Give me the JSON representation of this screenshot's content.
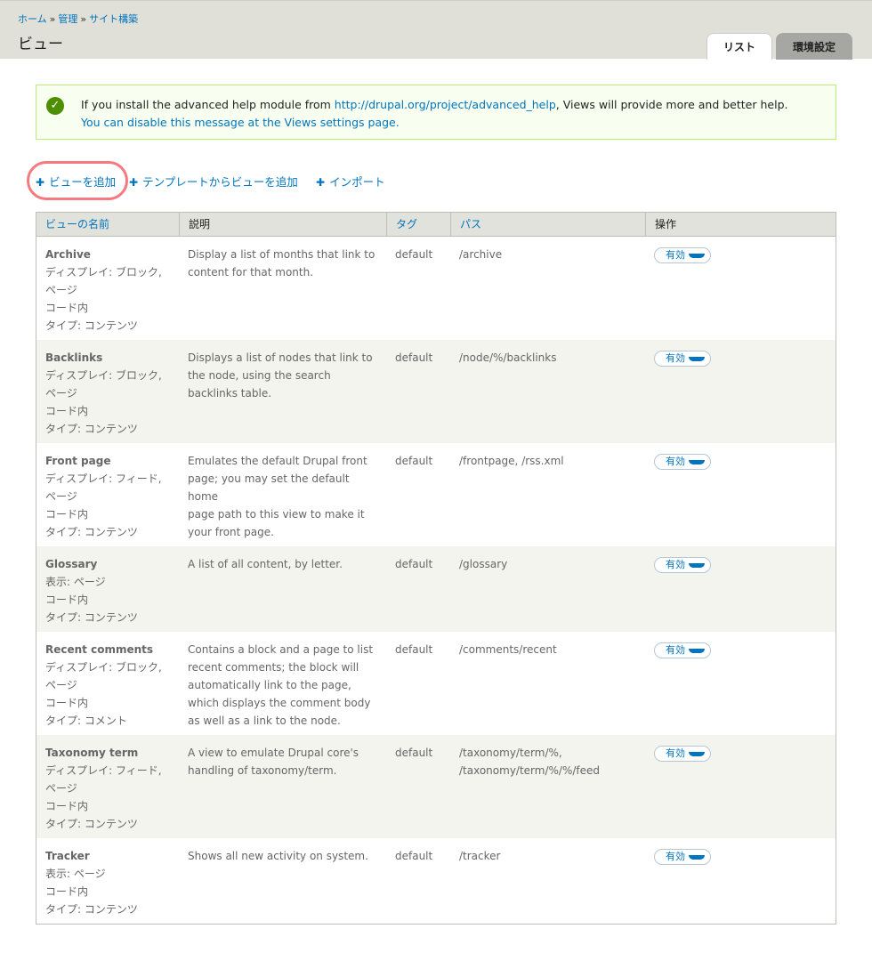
{
  "breadcrumb": [
    "ホーム",
    "管理",
    "サイト構築"
  ],
  "breadcrumb_sep": "»",
  "page_title": "ビュー",
  "tabs": [
    {
      "label": "リスト",
      "active": true
    },
    {
      "label": "環境設定",
      "active": false
    }
  ],
  "message": {
    "text_before": "If you install the advanced help module from ",
    "link": "http://drupal.org/project/advanced_help",
    "text_after": ", Views will provide more and better help.",
    "line2": "You can disable this message at the Views settings page."
  },
  "actions": [
    "ビューを追加",
    "テンプレートからビューを追加",
    "インポート"
  ],
  "table": {
    "headers": [
      "ビューの名前",
      "説明",
      "タグ",
      "パス",
      "操作"
    ],
    "op_label": "有効",
    "rows": [
      {
        "name": "Archive",
        "meta": [
          "ディスプレイ: ブロック,",
          "ページ",
          "コード内",
          "タイプ: コンテンツ"
        ],
        "desc": [
          "Display a list of months that link to",
          "content for that month."
        ],
        "tag": "default",
        "path": [
          "/archive"
        ]
      },
      {
        "name": "Backlinks",
        "meta": [
          "ディスプレイ: ブロック,",
          "ページ",
          "コード内",
          "タイプ: コンテンツ"
        ],
        "desc": [
          "Displays a list of nodes that link to",
          "the node, using the search",
          "backlinks table."
        ],
        "tag": "default",
        "path": [
          "/node/%/backlinks"
        ]
      },
      {
        "name": "Front page",
        "meta": [
          "ディスプレイ: フィード,",
          "ページ",
          "コード内",
          "タイプ: コンテンツ"
        ],
        "desc": [
          "Emulates the default Drupal front",
          "page; you may set the default home",
          "page path to this view to make it",
          "your front page."
        ],
        "tag": "default",
        "path": [
          "/frontpage, /rss.xml"
        ]
      },
      {
        "name": "Glossary",
        "meta": [
          "表示: ページ",
          "コード内",
          "タイプ: コンテンツ"
        ],
        "desc": [
          "A list of all content, by letter."
        ],
        "tag": "default",
        "path": [
          "/glossary"
        ]
      },
      {
        "name": "Recent comments",
        "meta": [
          "ディスプレイ: ブロック,",
          "ページ",
          "コード内",
          "タイプ: コメント"
        ],
        "desc": [
          "Contains a block and a page to list",
          "recent comments; the block will",
          "automatically link to the page,",
          "which displays the comment body",
          "as well as a link to the node."
        ],
        "tag": "default",
        "path": [
          "/comments/recent"
        ]
      },
      {
        "name": "Taxonomy term",
        "meta": [
          "ディスプレイ: フィード,",
          "ページ",
          "コード内",
          "タイプ: コンテンツ"
        ],
        "desc": [
          "A view to emulate Drupal core's",
          "handling of taxonomy/term."
        ],
        "tag": "default",
        "path": [
          "/taxonomy/term/%,",
          "/taxonomy/term/%/%/feed"
        ]
      },
      {
        "name": "Tracker",
        "meta": [
          "表示: ページ",
          "コード内",
          "タイプ: コンテンツ"
        ],
        "desc": [
          "Shows all new activity on system."
        ],
        "tag": "default",
        "path": [
          "/tracker"
        ]
      }
    ]
  }
}
